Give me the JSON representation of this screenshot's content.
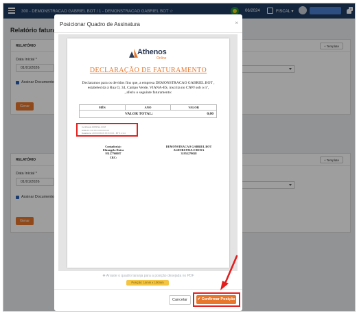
{
  "topbar": {
    "company": "300 - DEMONSTRACAO GABRIEL BOT / 1 - DEMONSTRACAO GABRIEL BOT ☆",
    "period": "06/2024",
    "module": "FISCAL ▾",
    "notif_count": "1"
  },
  "page_title": "Relatório faturamento",
  "cards": [
    {
      "header": "RELATÓRIO",
      "template_btn": "+ Template",
      "date_label": "Data Inicial *",
      "date_value": "01/01/2026",
      "checkbox_label": "Assinar Documento",
      "gerar": "Gerar"
    },
    {
      "header": "RELATÓRIO",
      "template_btn": "+ Template",
      "date_label": "Data Inicial *",
      "date_value": "01/01/2026",
      "checkbox_label": "Assinar Documento",
      "gerar": "Gerar"
    }
  ],
  "modal": {
    "title": "Posicionar Quadro de Assinatura",
    "close": "×",
    "logo_name": "Athenos",
    "logo_sub": "Online",
    "doc_title": "DECLARAÇÃO DE FATURAMENTO",
    "paragraph_1": "Declaramos para os devidos fins que, a empresa DEMONSTRACAO GABRIEL BOT ,",
    "paragraph_2": "estabelecida à Rua O, 34, Campo Verde, VIANA-ES, inscrita no CNPJ sob o nº,",
    "paragraph_3": ", aferiu o seguinte faturamento:",
    "table_headers": [
      "MÊS",
      "ANO",
      "VALOR"
    ],
    "total_label": "VALOR TOTAL:",
    "total_value": "0,00",
    "sig_box_lines": [
      "Certificado DIPRISA.COM",
      "DIRE-FL:XX.XXX.XXX/XX-XX",
      "Data/Hora: 2X/XX/XXXX XX:XX:XX - BT 5.1.3.4"
    ],
    "signer_left": [
      "Contador(a):",
      "Elizangela Dutra",
      "93127760087",
      "CRC:"
    ],
    "signer_right": [
      "DEMONSTRACAO GABRIEL BOT",
      "ALDORI PAULO ROSA",
      "31955279028"
    ],
    "hint": "Arraste o quadro laranja para a posição desejada no PDF",
    "position_badge": "Posição: 14mm x 100mm",
    "cancel": "Cancelar",
    "confirm": "✔ Confirmar Posição"
  },
  "colors": {
    "accent": "#e8762b",
    "highlight": "#e41d1d",
    "topbar": "#1f3d63"
  }
}
